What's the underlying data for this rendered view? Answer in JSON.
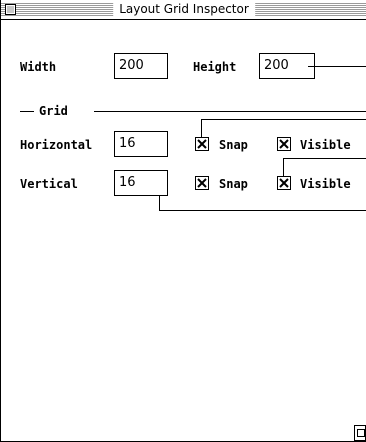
{
  "window": {
    "title": "Layout Grid Inspector"
  },
  "size": {
    "width_label": "Width",
    "width_value": "200",
    "height_label": "Height",
    "height_value": "200"
  },
  "grid": {
    "section_label": "Grid",
    "horizontal": {
      "label": "Horizontal",
      "value": "16",
      "snap_label": "Snap",
      "snap_checked": true,
      "visible_label": "Visible",
      "visible_checked": true
    },
    "vertical": {
      "label": "Vertical",
      "value": "16",
      "snap_label": "Snap",
      "snap_checked": true,
      "visible_label": "Visible",
      "visible_checked": true
    }
  }
}
